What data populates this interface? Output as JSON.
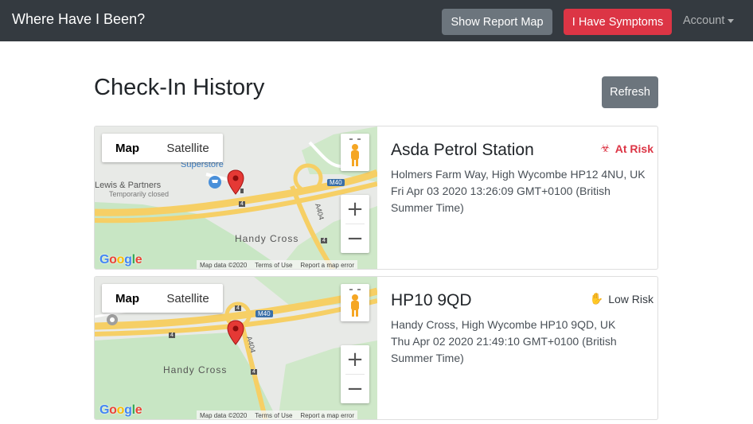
{
  "navbar": {
    "brand": "Where Have I Been?",
    "report_map_label": "Show Report Map",
    "symptoms_label": "I Have Symptoms",
    "account_label": "Account"
  },
  "page": {
    "title": "Check-In History",
    "refresh_label": "Refresh"
  },
  "map_controls": {
    "map_label": "Map",
    "satellite_label": "Satellite",
    "zoom_in": "+",
    "zoom_out": "−",
    "google_logo": "Google",
    "map_data": "Map data ©2020",
    "terms": "Terms of Use",
    "report_error": "Report a map error"
  },
  "checkins": [
    {
      "place": "Asda Petrol Station",
      "risk_label": "At Risk",
      "risk_icon": "biohazard-icon",
      "risk_color": "#dc3545",
      "address": "Holmers Farm Way, High Wycombe HP12 4NU, UK",
      "time": "Fri Apr 03 2020 13:26:09 GMT+0100 (British Summer Time)",
      "map_labels": [
        "Superstore",
        "Lewis & Partners",
        "Temporarily closed",
        "Handy Cross",
        "M40",
        "A404",
        "4",
        "4",
        "4"
      ]
    },
    {
      "place": "HP10 9QD",
      "risk_label": "Low Risk",
      "risk_icon": "hand-icon",
      "risk_color": "#343a40",
      "address": "Handy Cross, High Wycombe HP10 9QD, UK",
      "time": "Thu Apr 02 2020 21:49:10 GMT+0100 (British Summer Time)",
      "map_labels": [
        "Handy Cross",
        "M40",
        "A404",
        "4",
        "4",
        "4"
      ]
    }
  ]
}
